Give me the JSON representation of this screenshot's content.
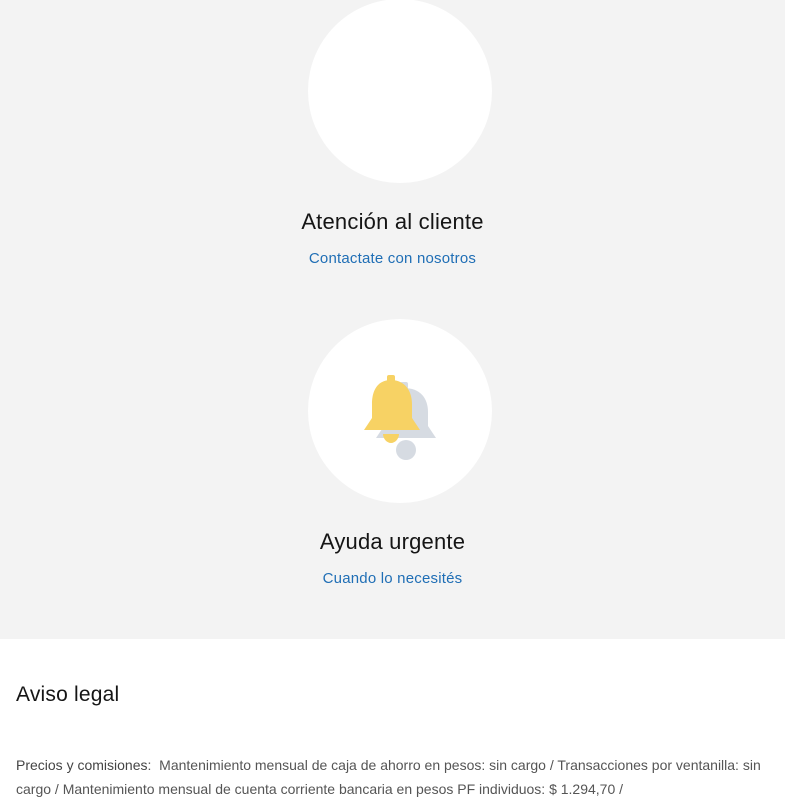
{
  "cards": [
    {
      "title": "Atención al cliente",
      "link": "Contactate con nosotros",
      "icon": "customer-service-icon"
    },
    {
      "title": "Ayuda urgente",
      "link": "Cuando lo necesités",
      "icon": "bell-icon"
    }
  ],
  "legal": {
    "title": "Aviso legal",
    "label": "Precios y comisiones",
    "separator": ":",
    "text": "Mantenimiento mensual de caja de ahorro en pesos: sin cargo / Transacciones por ventanilla: sin cargo / Mantenimiento mensual de cuenta corriente bancaria en pesos PF individuos: $ 1.294,70 /"
  },
  "colors": {
    "link": "#1f6eb5",
    "section_bg": "#f3f3f3",
    "bell_yellow": "#f7d264",
    "bell_shadow": "#cfd5de"
  }
}
